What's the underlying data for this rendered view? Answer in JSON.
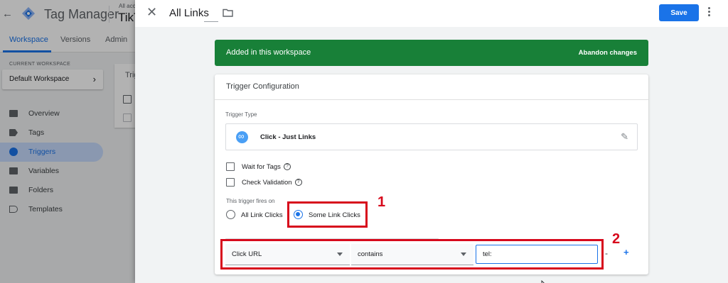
{
  "background": {
    "app_name": "Tag Manager",
    "account_caption": "All acc",
    "account_name": "TikT",
    "tabs": [
      "Workspace",
      "Versions",
      "Admin"
    ],
    "current_workspace_label": "CURRENT WORKSPACE",
    "workspace_name": "Default Workspace",
    "nav": [
      {
        "label": "Overview",
        "icon": "overview-icon"
      },
      {
        "label": "Tags",
        "icon": "tag-icon"
      },
      {
        "label": "Triggers",
        "icon": "trigger-icon",
        "active": true
      },
      {
        "label": "Variables",
        "icon": "variables-icon"
      },
      {
        "label": "Folders",
        "icon": "folder-icon"
      },
      {
        "label": "Templates",
        "icon": "template-icon"
      }
    ],
    "card_partial": "Trig"
  },
  "panel": {
    "title": "All Links",
    "save_label": "Save",
    "banner_text": "Added in this workspace",
    "banner_action": "Abandon changes",
    "card_title": "Trigger Configuration",
    "trigger_type_label": "Trigger Type",
    "trigger_type": "Click - Just Links",
    "options": {
      "wait_for_tags": "Wait for Tags",
      "check_validation": "Check Validation"
    },
    "fires_on_label": "This trigger fires on",
    "fires_on": {
      "all": "All Link Clicks",
      "some": "Some Link Clicks",
      "selected": "some"
    },
    "filter": {
      "variable": "Click URL",
      "operator": "contains",
      "value": "tel:"
    },
    "minus": "-",
    "plus": "+"
  },
  "annotations": {
    "marker_1": "1",
    "marker_2": "2",
    "color": "#d7091c"
  },
  "colors": {
    "accent": "#1a73e8",
    "banner": "#188038"
  }
}
